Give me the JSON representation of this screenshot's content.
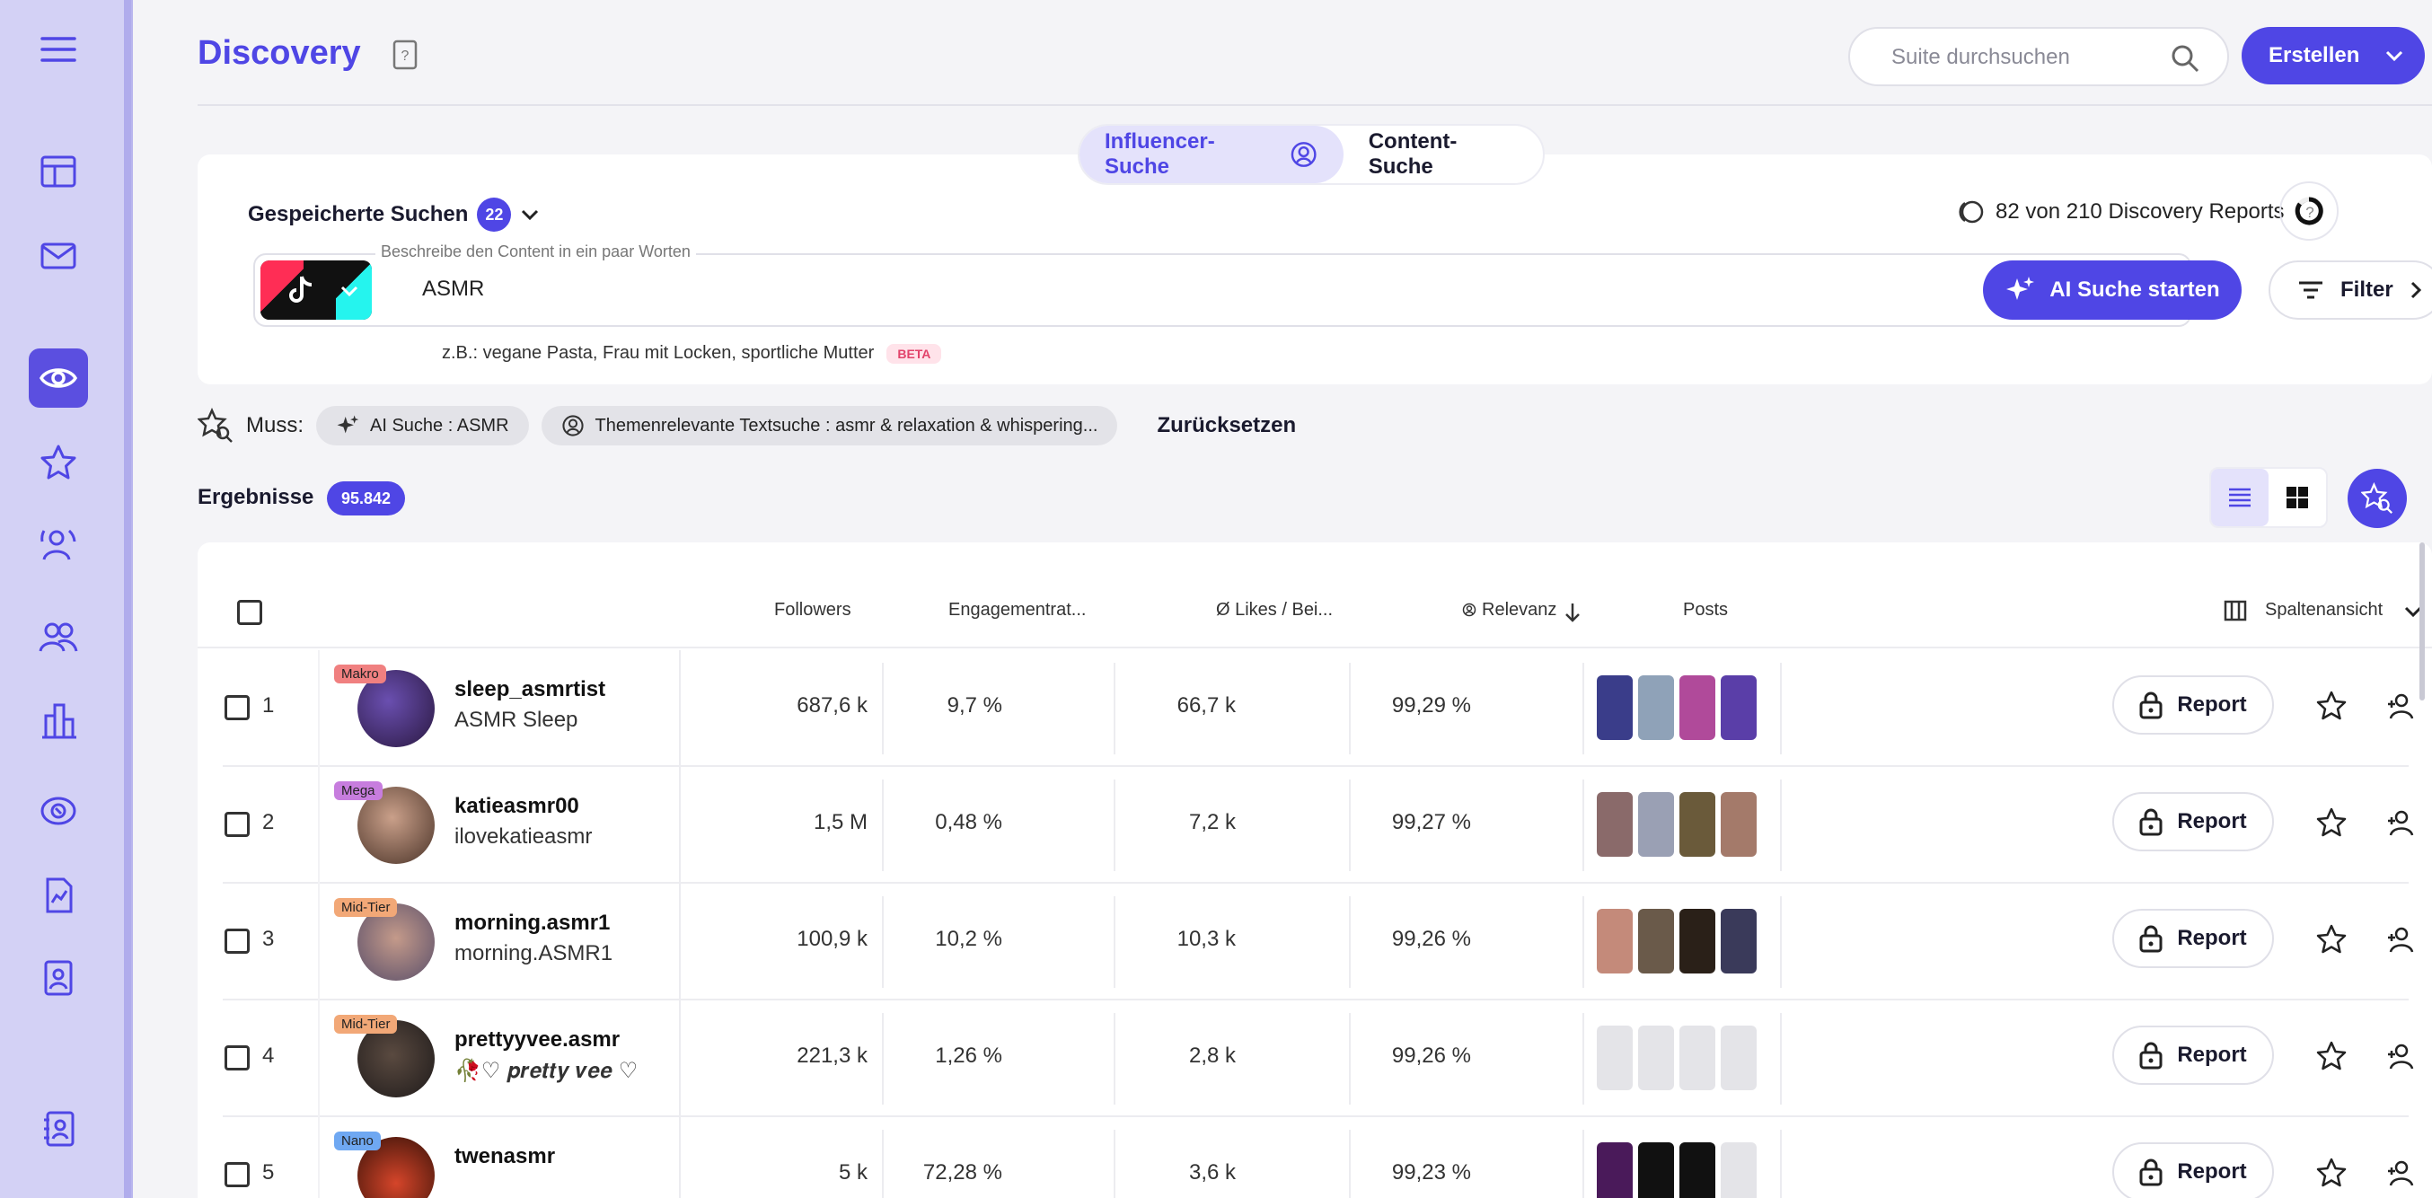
{
  "page": {
    "title": "Discovery"
  },
  "header": {
    "search_placeholder": "Suite durchsuchen",
    "create_label": "Erstellen"
  },
  "tabs": [
    {
      "label": "Influencer-Suche",
      "active": true
    },
    {
      "label": "Content-Suche",
      "active": false
    }
  ],
  "saved_searches": {
    "label": "Gespeicherte Suchen",
    "count": "22"
  },
  "reports_quota": "82 von 210 Discovery Reports",
  "query": {
    "label": "Beschreibe den Content in ein paar Worten",
    "value": "ASMR",
    "platform": "TikTok",
    "ai_button": "AI Suche starten",
    "filter_button": "Filter",
    "hint": "z.B.: vegane Pasta, Frau mit Locken, sportliche Mutter",
    "beta": "BETA"
  },
  "must": {
    "label": "Muss:",
    "chips": [
      "AI Suche : ASMR",
      "Themenrelevante Textsuche : asmr & relaxation & whispering..."
    ],
    "reset": "Zurücksetzen"
  },
  "results": {
    "label": "Ergebnisse",
    "count": "95.842"
  },
  "table": {
    "columns": {
      "followers": "Followers",
      "engagement": "Engagementrat...",
      "likes": "Ø Likes / Bei...",
      "relevance": "Relevanz",
      "posts": "Posts",
      "columns_view": "Spaltenansicht"
    },
    "report_label": "Report",
    "rows": [
      {
        "num": "1",
        "tier": "Makro",
        "username": "sleep_asmrtist",
        "display": "ASMR Sleep",
        "followers": "687,6 k",
        "engagement": "9,7 %",
        "likes": "66,7 k",
        "relevance": "99,29 %"
      },
      {
        "num": "2",
        "tier": "Mega",
        "username": "katieasmr00",
        "display": "ilovekatieasmr",
        "followers": "1,5 M",
        "engagement": "0,48 %",
        "likes": "7,2 k",
        "relevance": "99,27 %"
      },
      {
        "num": "3",
        "tier": "Mid-Tier",
        "username": "morning.asmr1",
        "display": "morning.ASMR1",
        "followers": "100,9 k",
        "engagement": "10,2 %",
        "likes": "10,3 k",
        "relevance": "99,26 %"
      },
      {
        "num": "4",
        "tier": "Mid-Tier",
        "username": "prettyyvee.asmr",
        "display": "🥀♡ 𝒑𝒓𝒆𝒕𝒕𝒚 𝒗𝒆𝒆 ♡",
        "followers": "221,3 k",
        "engagement": "1,26 %",
        "likes": "2,8 k",
        "relevance": "99,26 %"
      },
      {
        "num": "5",
        "tier": "Nano",
        "username": "twenasmr",
        "display": "",
        "followers": "5 k",
        "engagement": "72,28 %",
        "likes": "3,6 k",
        "relevance": "99,23 %"
      }
    ]
  },
  "colors": {
    "accent": "#4f46e5",
    "sidebar": "#d3d1f5",
    "tier_makro": "#f08080",
    "tier_mega": "#c77dde",
    "tier_midtier": "#f2a877",
    "tier_nano": "#6fa8f2"
  }
}
